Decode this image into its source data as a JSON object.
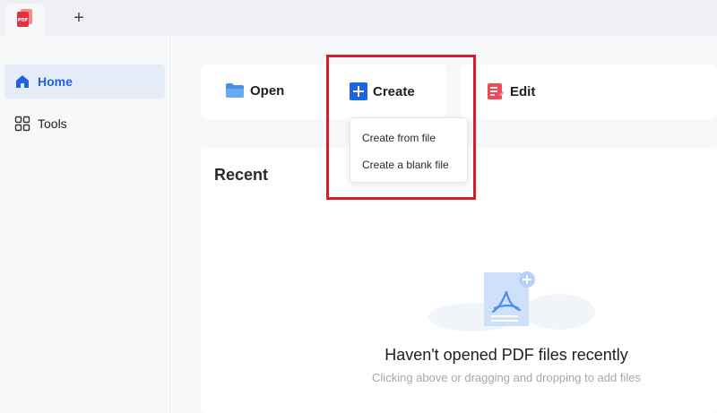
{
  "tabbar": {
    "app_icon": "pdf-app-icon",
    "new_tab_label": "+"
  },
  "sidebar": {
    "items": [
      {
        "label": "Home",
        "icon": "home-icon",
        "active": true
      },
      {
        "label": "Tools",
        "icon": "grid-icon",
        "active": false
      }
    ]
  },
  "actions": {
    "open": {
      "label": "Open",
      "icon": "folder-icon"
    },
    "create": {
      "label": "Create",
      "icon": "plus-square-icon"
    },
    "edit": {
      "label": "Edit",
      "icon": "edit-document-icon"
    }
  },
  "create_menu": {
    "items": [
      "Create from file",
      "Create a blank file"
    ]
  },
  "recent": {
    "title": "Recent",
    "empty_title": "Haven't opened PDF files recently",
    "empty_subtitle": "Clicking above or dragging and dropping to add files"
  },
  "colors": {
    "accent": "#1f63e0",
    "highlight": "#d1202b",
    "brand": "#e0323d",
    "edit_icon": "#ee4b56"
  }
}
